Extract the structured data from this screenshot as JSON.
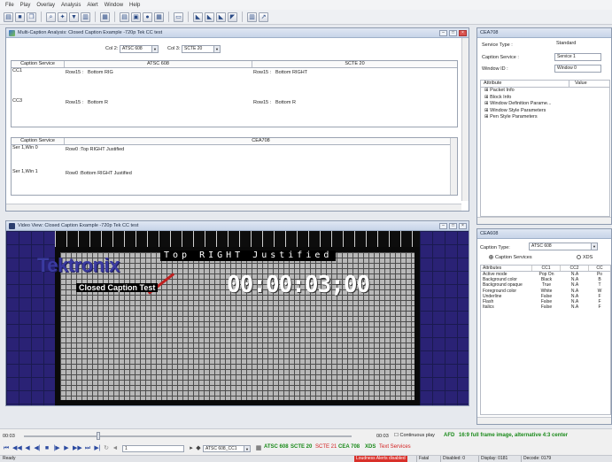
{
  "menu": [
    "File",
    "Play",
    "Overlay",
    "Analysis",
    "Alert",
    "Window",
    "Help"
  ],
  "toolbar_icons": [
    "open-icon",
    "save-icon",
    "copy-icon",
    "search-icon",
    "zoom-icon",
    "filter-icon",
    "chart-icon",
    "table-icon",
    "grid-icon",
    "settings-icon",
    "window-icon",
    "video-icon",
    "audio-icon",
    "caption-icon",
    "layout-icon"
  ],
  "multi_caption": {
    "title": "Multi-Caption Analysis: Closed Caption Example -720p Tek CC test",
    "col2_label": "Col 2:",
    "col2_value": "ATSC 608",
    "col3_label": "Col 3:",
    "col3_value": "SCTE 20",
    "grid1": {
      "headers": [
        "Caption Service",
        "ATSC 608",
        "SCTE 20"
      ],
      "rows": [
        {
          "service": "CC1",
          "a_row": "Row15 :",
          "a_text": "Bottom RIG",
          "s_row": "Row15 :",
          "s_text": "Bottom RIGHT"
        },
        {
          "service": "CC3",
          "a_row": "Row15 :",
          "a_text": "Bottom R",
          "s_row": "Row15 :",
          "s_text": "Bottom R"
        }
      ]
    },
    "grid2": {
      "headers": [
        "Caption Service",
        "CEA708"
      ],
      "rows": [
        {
          "service": "Ser 1,Win 0",
          "text": "Row0 :Top RIGHT Justified"
        },
        {
          "service": "Ser 1,Win 1",
          "text": "Row0 :Bottom RIGHT Justified"
        }
      ]
    }
  },
  "video": {
    "title": "Video View: Closed Caption Example -720p Tek CC test",
    "logo": "Tektronix",
    "caption_line": "Top RIGHT Justified",
    "caption_sub": "Closed Caption Test",
    "timecode": "00:00:03;00"
  },
  "cea708": {
    "title": "CEA708",
    "service_type_label": "Service Type :",
    "service_type_value": "Standard",
    "caption_service_label": "Caption Service :",
    "caption_service_value": "Service 1",
    "window_id_label": "Window ID :",
    "window_id_value": "Window 0",
    "attr_header": "Attribute",
    "value_header": "Value",
    "attributes": [
      "Packet Info",
      "Block Info",
      "Window Definition Parame...",
      "Window Style Parameters",
      "Pen Style Parameters"
    ]
  },
  "cea608": {
    "title": "CEA608",
    "caption_type_label": "Caption Type:",
    "caption_type_value": "ATSC 608",
    "radio_caption_services": "Caption Services",
    "radio_xds": "XDS",
    "headers": [
      "Attributes",
      "CC1",
      "CC2",
      "CC"
    ],
    "rows": [
      [
        "Active mode",
        "Pop On",
        "N.A",
        "Po"
      ],
      [
        "Background color",
        "Black",
        "N.A",
        "B"
      ],
      [
        "Background opaque",
        "True",
        "N.A",
        "T"
      ],
      [
        "Foreground color",
        "White",
        "N.A",
        "W"
      ],
      [
        "Underline",
        "False",
        "N.A",
        "F"
      ],
      [
        "Flash",
        "False",
        "N.A",
        "F"
      ],
      [
        "Italics",
        "False",
        "N.A",
        "F"
      ]
    ]
  },
  "transport": {
    "time_left": "00:03",
    "time_right": "00:03",
    "continuous_play": "Continuous play",
    "afd": "AFD",
    "afd_desc": "16:9 full frame image, alternative 4:3 center",
    "pid_value": "1",
    "service_value": "ATSC 608_CC1",
    "links": [
      "ATSC 608",
      "SCTE 20",
      "SCTE 21",
      "CEA 708",
      "XDS",
      "Text Services"
    ]
  },
  "status": {
    "ready": "Ready",
    "alerts": "Loudness Alerts disabled",
    "fatal": "Fatal",
    "disabled": "Disabled: 0",
    "display": "Display: 0181",
    "decode": "Decode: 0179"
  },
  "colors": {
    "link_green": "#1a8a1a",
    "link_red": "#d22020",
    "alert_red": "#d9302a",
    "logo_blue": "#3a3aa0",
    "video_blue": "#2a2275"
  }
}
